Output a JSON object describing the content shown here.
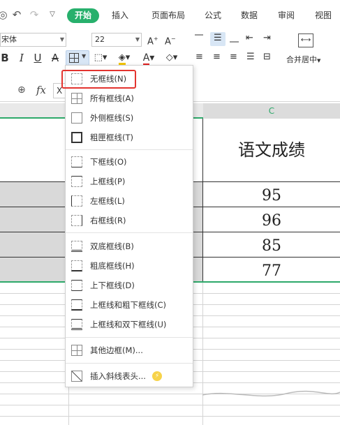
{
  "ribbon": {
    "tabs": [
      {
        "label": "开始",
        "active": true
      },
      {
        "label": "插入"
      },
      {
        "label": "页面布局"
      },
      {
        "label": "公式"
      },
      {
        "label": "数据"
      },
      {
        "label": "审阅"
      },
      {
        "label": "视图"
      }
    ],
    "accent_color": "#27b06c"
  },
  "toolbar": {
    "font_name": "宋体",
    "font_size": "22",
    "bold": "B",
    "italic": "I",
    "underline": "U",
    "strikethrough": "A",
    "font_color_letter": "A",
    "merge_label": "合并居中"
  },
  "formula_bar": {
    "fx_label": "fx",
    "cell_ref_partial": "X"
  },
  "sheet": {
    "column_c_label": "C",
    "header_text": "语文成绩",
    "values": [
      "95",
      "96",
      "85",
      "77"
    ]
  },
  "border_menu": {
    "items": [
      {
        "label": "无框线(N)"
      },
      {
        "label": "所有框线(A)"
      },
      {
        "label": "外侧框线(S)"
      },
      {
        "label": "粗匣框线(T)"
      },
      {
        "label": "下框线(O)"
      },
      {
        "label": "上框线(P)"
      },
      {
        "label": "左框线(L)"
      },
      {
        "label": "右框线(R)"
      },
      {
        "label": "双底框线(B)"
      },
      {
        "label": "粗底框线(H)"
      },
      {
        "label": "上下框线(D)"
      },
      {
        "label": "上框线和粗下框线(C)"
      },
      {
        "label": "上框线和双下框线(U)"
      },
      {
        "label": "其他边框(M)..."
      },
      {
        "label": "插入斜线表头..."
      }
    ],
    "highlighted_index": 0,
    "highlight_color": "#e3342f"
  }
}
